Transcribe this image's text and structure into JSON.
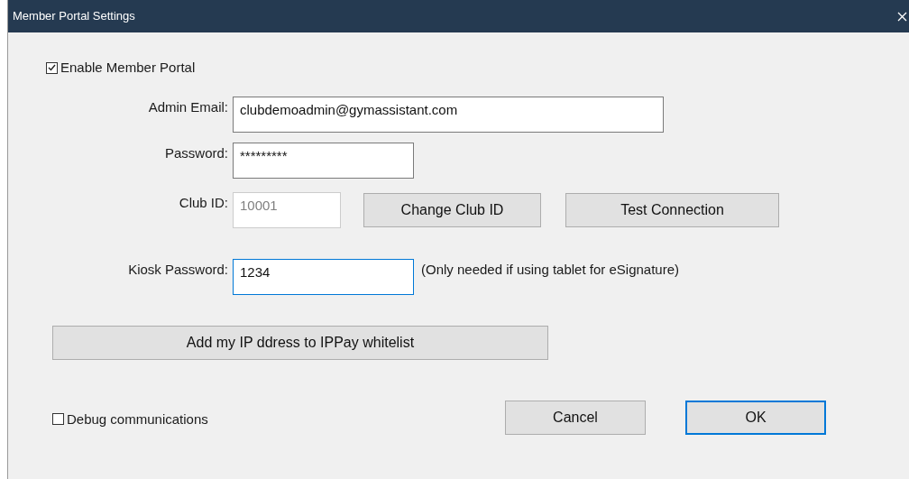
{
  "window": {
    "title": "Member Portal Settings"
  },
  "enable_portal": {
    "label": "Enable Member Portal",
    "checked": true
  },
  "admin_email": {
    "label": "Admin Email:",
    "value": "clubdemoadmin@gymassistant.com",
    "disabled": false,
    "focused": false
  },
  "password": {
    "label": "Password:",
    "value": "*********",
    "disabled": false,
    "focused": false
  },
  "club_id": {
    "label": "Club ID:",
    "value": "10001",
    "disabled": true,
    "focused": false
  },
  "club_buttons": [
    {
      "label": "Change Club ID",
      "default": false
    },
    {
      "label": "Test Connection",
      "default": false
    }
  ],
  "kiosk_password": {
    "label": "Kiosk Password:",
    "value": "1234",
    "disabled": false,
    "focused": true,
    "note": "(Only needed if using tablet for eSignature)"
  },
  "whitelist_button": {
    "label": "Add my IP ddress to IPPay whitelist",
    "default": false
  },
  "debug": {
    "label": "Debug communications",
    "checked": false
  },
  "buttons": [
    {
      "label": "Cancel",
      "default": false
    },
    {
      "label": "OK",
      "default": true
    }
  ]
}
